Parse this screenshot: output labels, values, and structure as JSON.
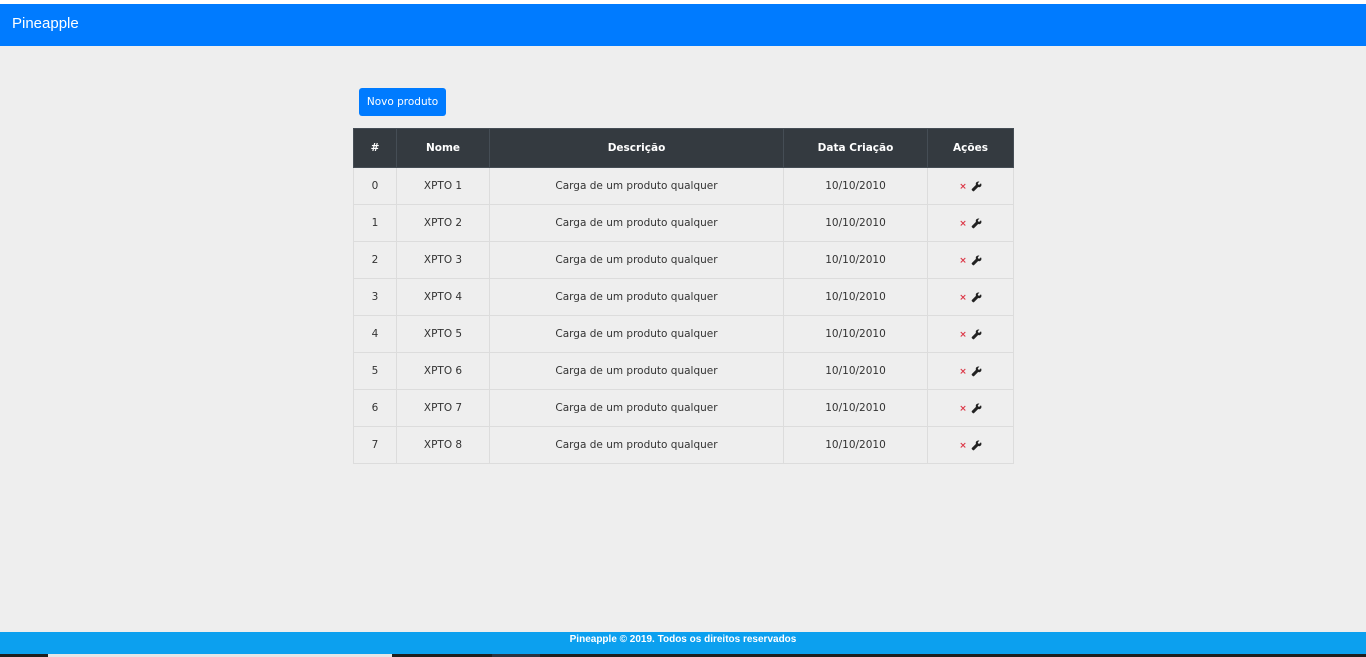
{
  "app": {
    "brand": "Pineapple"
  },
  "toolbar": {
    "new_product_label": "Novo produto"
  },
  "table": {
    "headers": [
      "#",
      "Nome",
      "Descrição",
      "Data Criação",
      "Ações"
    ],
    "rows": [
      {
        "id": "0",
        "name": "XPTO 1",
        "description": "Carga de um produto qualquer",
        "date": "10/10/2010"
      },
      {
        "id": "1",
        "name": "XPTO 2",
        "description": "Carga de um produto qualquer",
        "date": "10/10/2010"
      },
      {
        "id": "2",
        "name": "XPTO 3",
        "description": "Carga de um produto qualquer",
        "date": "10/10/2010"
      },
      {
        "id": "3",
        "name": "XPTO 4",
        "description": "Carga de um produto qualquer",
        "date": "10/10/2010"
      },
      {
        "id": "4",
        "name": "XPTO 5",
        "description": "Carga de um produto qualquer",
        "date": "10/10/2010"
      },
      {
        "id": "5",
        "name": "XPTO 6",
        "description": "Carga de um produto qualquer",
        "date": "10/10/2010"
      },
      {
        "id": "6",
        "name": "XPTO 7",
        "description": "Carga de um produto qualquer",
        "date": "10/10/2010"
      },
      {
        "id": "7",
        "name": "XPTO 8",
        "description": "Carga de um produto qualquer",
        "date": "10/10/2010"
      }
    ],
    "action_icons": {
      "delete": "close-icon",
      "edit": "wrench-icon"
    },
    "delete_glyph": "×"
  },
  "footer": {
    "text": "Pineapple © 2019. Todos os direitos reservados"
  },
  "colors": {
    "navbar": "#007bff",
    "button": "#007bff",
    "table_header": "#343a40",
    "footer": "#0ca0ef",
    "delete_icon": "#dc3545",
    "background": "#eeeeee"
  }
}
